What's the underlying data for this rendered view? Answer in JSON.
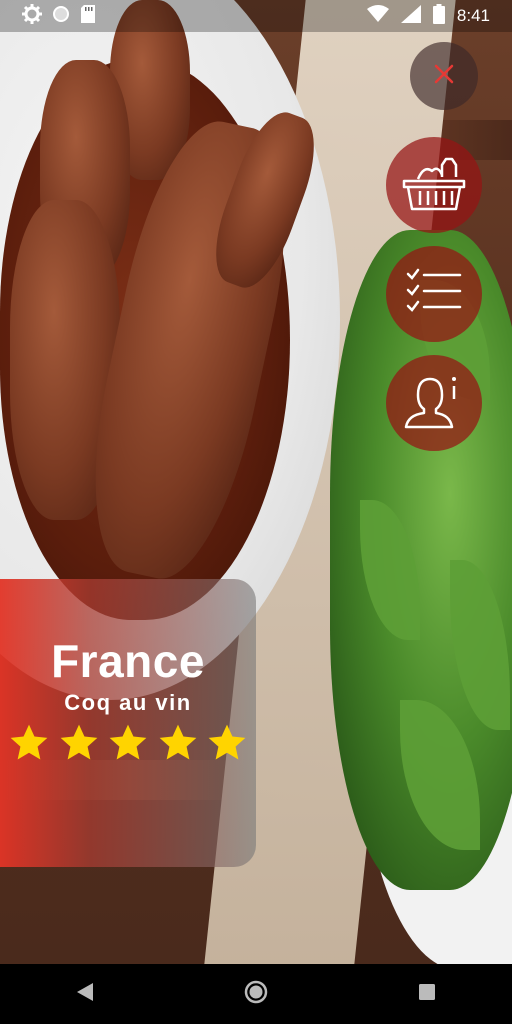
{
  "status_bar": {
    "time": "8:41",
    "icons_left": [
      "gear-icon",
      "circle-icon",
      "sd-card-icon"
    ],
    "icons_right": [
      "wifi-icon",
      "signal-icon",
      "battery-icon"
    ]
  },
  "background": {
    "description_icon": "food-photo"
  },
  "actions": {
    "close": {
      "icon": "close-icon",
      "color": "#e53935"
    },
    "items": [
      {
        "icon": "shopping-basket-icon"
      },
      {
        "icon": "checklist-icon"
      },
      {
        "icon": "chef-info-icon"
      }
    ],
    "button_color": "#961414"
  },
  "recipe_card": {
    "country": "France",
    "dish": "Coq au vin",
    "rating": 5,
    "rating_max": 5,
    "star_color": "#ffd400",
    "accent": "#e23426"
  },
  "nav_bar": {
    "buttons": [
      "back-icon",
      "home-icon",
      "recents-icon"
    ]
  }
}
